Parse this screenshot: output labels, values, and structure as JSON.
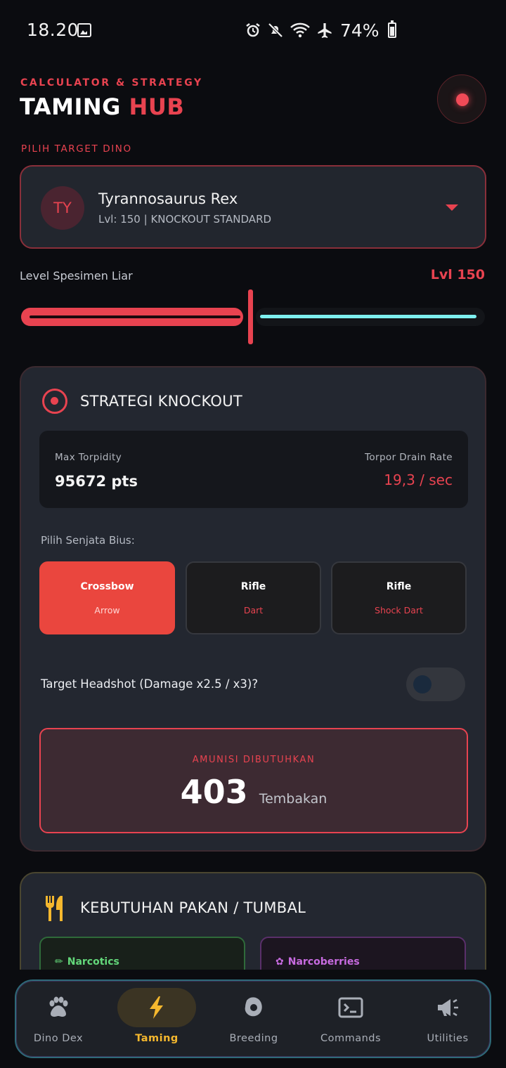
{
  "status_bar": {
    "time": "18.20",
    "battery": "74%"
  },
  "header": {
    "subtitle": "CALCULATOR & STRATEGY",
    "title_part1": "TAMING",
    "title_part2": "HUB"
  },
  "target_section": {
    "label": "PILIH TARGET DINO"
  },
  "dino": {
    "initials": "TY",
    "name": "Tyrannosaurus Rex",
    "meta": "Lvl: 150 | KNOCKOUT STANDARD"
  },
  "level": {
    "label": "Level Spesimen Liar",
    "value": "Lvl 150",
    "slider_fraction": 0.49
  },
  "knockout": {
    "title": "STRATEGI KNOCKOUT",
    "max_torpidity_label": "Max Torpidity",
    "max_torpidity_value": "95672 pts",
    "drain_label": "Torpor Drain Rate",
    "drain_value": "19,3 / sec",
    "weapon_label": "Pilih Senjata Bius:",
    "weapons": [
      {
        "name": "Crossbow",
        "type": "Arrow",
        "active": true
      },
      {
        "name": "Rifle",
        "type": "Dart",
        "active": false
      },
      {
        "name": "Rifle",
        "type": "Shock Dart",
        "active": false
      }
    ],
    "headshot_label": "Target Headshot (Damage x2.5 / x3)?",
    "headshot_enabled": false,
    "ammo_label": "AMUNISI DIBUTUHKAN",
    "ammo_value": "403",
    "ammo_unit": "Tembakan"
  },
  "food": {
    "title": "KEBUTUHAN PAKAN / TUMBAL",
    "items": [
      {
        "label": "Narcotics",
        "icon": "syringe-icon"
      },
      {
        "label": "Narcoberries",
        "icon": "grapes-icon"
      }
    ]
  },
  "nav": {
    "items": [
      {
        "label": "Dino Dex",
        "icon": "paw-icon"
      },
      {
        "label": "Taming",
        "icon": "lightning-icon",
        "active": true
      },
      {
        "label": "Breeding",
        "icon": "egg-icon"
      },
      {
        "label": "Commands",
        "icon": "terminal-icon"
      },
      {
        "label": "Utilities",
        "icon": "megaphone-icon"
      }
    ]
  },
  "colors": {
    "accent": "#e84350",
    "active_weapon": "#ea463e",
    "nav_active": "#f5b82e",
    "slider_track": "#7ef0f0"
  }
}
